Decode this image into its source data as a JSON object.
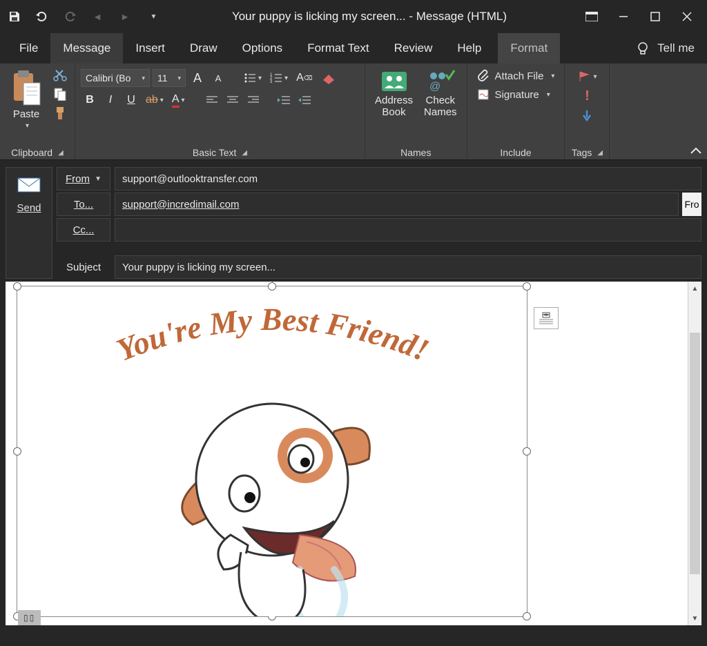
{
  "window": {
    "title": "Your puppy is licking my screen...  -  Message (HTML)"
  },
  "tabs": {
    "file": "File",
    "message": "Message",
    "insert": "Insert",
    "draw": "Draw",
    "options": "Options",
    "format_text": "Format Text",
    "review": "Review",
    "help": "Help",
    "format": "Format",
    "tell_me": "Tell me"
  },
  "ribbon": {
    "clipboard": {
      "label": "Clipboard",
      "paste": "Paste"
    },
    "basic_text": {
      "label": "Basic Text",
      "font": "Calibri (Bo",
      "size": "11",
      "bold": "B",
      "italic": "I",
      "underline": "U"
    },
    "names": {
      "label": "Names",
      "address_book": "Address\nBook",
      "check_names": "Check\nNames"
    },
    "include": {
      "label": "Include",
      "attach_file": "Attach File",
      "signature": "Signature"
    },
    "tags": {
      "label": "Tags"
    }
  },
  "compose": {
    "send": "Send",
    "from_label": "From",
    "from_value": "support@outlooktransfer.com",
    "to_label": "To...",
    "to_value": "support@incredimail.com",
    "cc_label": "Cc...",
    "cc_value": "",
    "subject_label": "Subject",
    "subject_value": "Your puppy is licking my screen...",
    "fro_cut": "Fro"
  },
  "body": {
    "arc_text": "You're My Best Friend!",
    "bottom_tag": "▯▯"
  }
}
